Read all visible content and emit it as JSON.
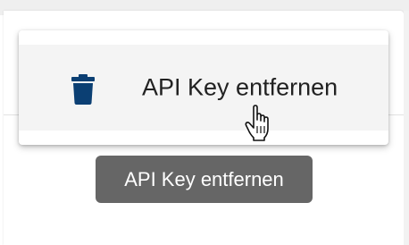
{
  "menu": {
    "items": [
      {
        "label": "API Key entfernen",
        "icon": "trash-icon"
      }
    ]
  },
  "tooltip": {
    "text": "API Key entfernen"
  },
  "colors": {
    "icon": "#0b3f73",
    "tooltip_bg": "#666666",
    "menu_item_hover_bg": "#f4f4f4",
    "text": "#222222"
  }
}
